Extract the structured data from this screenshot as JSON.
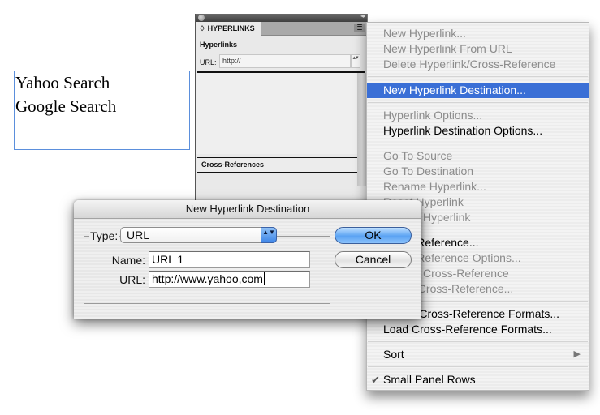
{
  "document": {
    "text_lines": [
      "Yahoo Search",
      "Google Search"
    ]
  },
  "panel": {
    "tab_label": "♢ HYPERLINKS",
    "collapse_icon": "◂◂",
    "menu_icon": "≣",
    "hyperlinks_title": "Hyperlinks",
    "url_label": "URL:",
    "url_value": "http://",
    "spin_icon": "▴▾",
    "cross_references_title": "Cross-References"
  },
  "menu": {
    "items": [
      {
        "label": "New Hyperlink...",
        "state": "disabled"
      },
      {
        "label": "New Hyperlink From URL",
        "state": "disabled"
      },
      {
        "label": "Delete Hyperlink/Cross-Reference",
        "state": "disabled"
      },
      {
        "label": "New Hyperlink Destination...",
        "state": "selected"
      },
      {
        "label": "Hyperlink Options...",
        "state": "disabled"
      },
      {
        "label": "Hyperlink Destination Options...",
        "state": "enabled"
      },
      {
        "label": "Go To Source",
        "state": "disabled"
      },
      {
        "label": "Go To Destination",
        "state": "disabled"
      },
      {
        "label": "Rename Hyperlink...",
        "state": "disabled"
      },
      {
        "label": "Reset Hyperlink",
        "state": "disabled"
      },
      {
        "label": "Update Hyperlink",
        "state": "disabled"
      },
      {
        "label": "Cross-Reference...",
        "state": "enabled"
      },
      {
        "label": "Cross-Reference Options...",
        "state": "disabled"
      },
      {
        "label": "Update Cross-Reference",
        "state": "disabled"
      },
      {
        "label": "Relink Cross-Reference...",
        "state": "disabled"
      },
      {
        "label": "Define Cross-Reference Formats...",
        "state": "enabled"
      },
      {
        "label": "Load Cross-Reference Formats...",
        "state": "enabled"
      },
      {
        "label": "Sort",
        "state": "enabled",
        "submenu_icon": "▶"
      },
      {
        "label": "Small Panel Rows",
        "state": "enabled",
        "check_icon": "✔"
      }
    ]
  },
  "dialog": {
    "title": "New Hyperlink Destination",
    "type_label": "Type:",
    "type_value": "URL",
    "stepper_icon": "▲▼",
    "name_label": "Name:",
    "name_value": "URL 1",
    "url_label": "URL:",
    "url_value": "http://www.yahoo,com",
    "ok_label": "OK",
    "cancel_label": "Cancel"
  },
  "colors": {
    "selection": "#3a6fd6",
    "default_button": "#5aa2f3",
    "frame_border": "#5b8fdc"
  }
}
